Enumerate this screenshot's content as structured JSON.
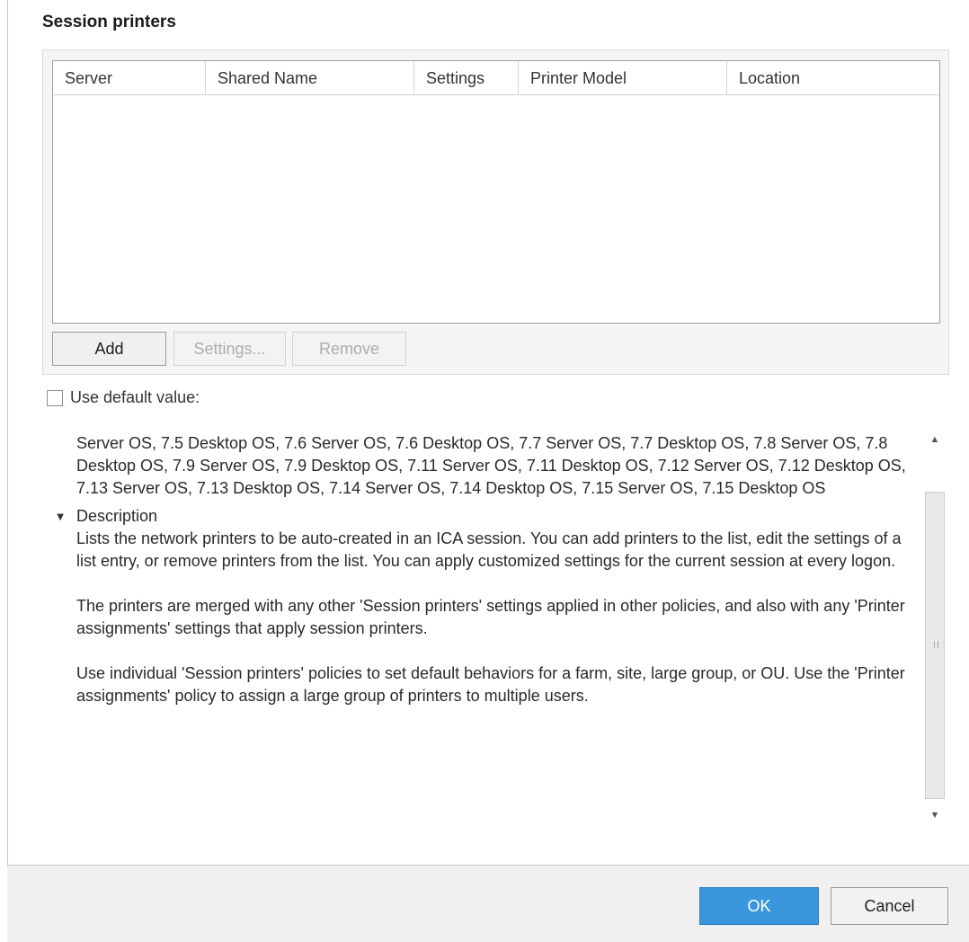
{
  "section_title": "Session printers",
  "table": {
    "columns": [
      "Server",
      "Shared Name",
      "Settings",
      "Printer Model",
      "Location"
    ],
    "rows": []
  },
  "buttons": {
    "add": "Add",
    "settings": "Settings...",
    "remove": "Remove",
    "ok": "OK",
    "cancel": "Cancel"
  },
  "use_default": {
    "label": "Use default value:",
    "checked": false
  },
  "details": {
    "applies_to_text": "Server OS, 7.5 Desktop OS, 7.6 Server OS, 7.6 Desktop OS, 7.7 Server OS, 7.7 Desktop OS, 7.8 Server OS, 7.8 Desktop OS, 7.9 Server OS, 7.9 Desktop OS, 7.11 Server OS, 7.11 Desktop OS, 7.12 Server OS, 7.12 Desktop OS, 7.13 Server OS, 7.13 Desktop OS, 7.14 Server OS, 7.14 Desktop OS, 7.15 Server OS, 7.15 Desktop OS",
    "description_heading": "Description",
    "paragraphs": [
      "Lists the network printers to be auto-created in an ICA session.  You can add printers to the list, edit the settings of a list entry, or remove printers from the list. You can apply customized settings for the current session at every logon.",
      "The printers are merged with any other 'Session printers' settings applied in other policies, and also with any 'Printer assignments' settings that apply session printers.",
      "Use individual 'Session printers' policies to set default behaviors for a farm, site, large group, or OU. Use the 'Printer assignments' policy to assign a large group of printers to multiple users."
    ]
  },
  "icons": {
    "expand": "caret-down-icon",
    "scroll_up": "scroll-up-arrow-icon",
    "scroll_down": "scroll-down-arrow-icon"
  },
  "colors": {
    "ok_button": "#3a96dd",
    "footer_bg": "#f0f0f0"
  }
}
